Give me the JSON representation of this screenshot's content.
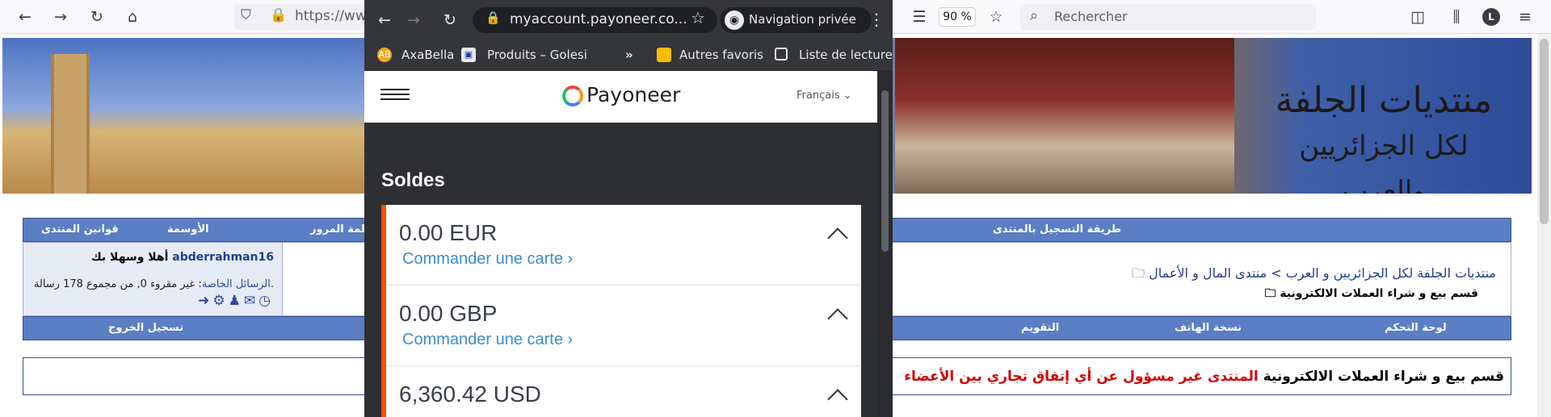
{
  "firefox": {
    "url_partial": "https://www",
    "zoom": "90 %",
    "search_placeholder": "Rechercher",
    "avatar_initial": "L"
  },
  "chrome": {
    "url": "myaccount.payoneer.co...",
    "incognito_label": "Navigation privée",
    "bookmarks": [
      {
        "label": "AxaBella",
        "icon": "axabella-icon"
      },
      {
        "label": "Produits – Golesi",
        "icon": "golesi-icon"
      },
      {
        "label": "Autres favoris",
        "icon": "folder-icon"
      },
      {
        "label": "Liste de lecture",
        "icon": "reading-list-icon"
      }
    ],
    "bookmarks_more": "»"
  },
  "payoneer": {
    "brand": "Payoneer",
    "language": "Français",
    "section_title": "Soldes",
    "balances": [
      {
        "amount": "0.00 EUR",
        "link": "Commander une carte"
      },
      {
        "amount": "0.00 GBP",
        "link": "Commander une carte"
      },
      {
        "amount": "6,360.42 USD",
        "link": ""
      }
    ],
    "accent_color": "#ff4d00"
  },
  "forum": {
    "logo_line1": "منتديات الجلفة",
    "logo_line2": "لكل الجزائريين والعرب",
    "top_nav": {
      "rules": "قوانين المنتدى",
      "medals": "الأوسمة",
      "password": "كلمة المرور",
      "register_method": "طريقة التسجيل بالمنتدى"
    },
    "welcome": {
      "greeting": "أهلا وسهلا بك",
      "username": "abderrahman16",
      "pm_label": "الرسائل الخاصة",
      "pm_text": ": غير مقروء 0, من مجموع 178 رسالة."
    },
    "breadcrumb": {
      "root": "منتديات الجلفة لكل الجزائريين و العرب",
      "separator": ">",
      "section": "منتدى المال و الأعمال",
      "current": "قسم بيع و شراء العملات الالكترونية"
    },
    "sub_nav": {
      "logout": "تسجيل الخروج",
      "calendar": "التقويم",
      "mobile": "نسخة الهاتف",
      "control_panel": "لوحة التحكم"
    },
    "notice": {
      "normal": "قسم بيع و شراء العملات الالكترونية",
      "strong": "المنتدى غير مسؤول عن أي إتفاق تجاري بين الأعضاء"
    }
  }
}
